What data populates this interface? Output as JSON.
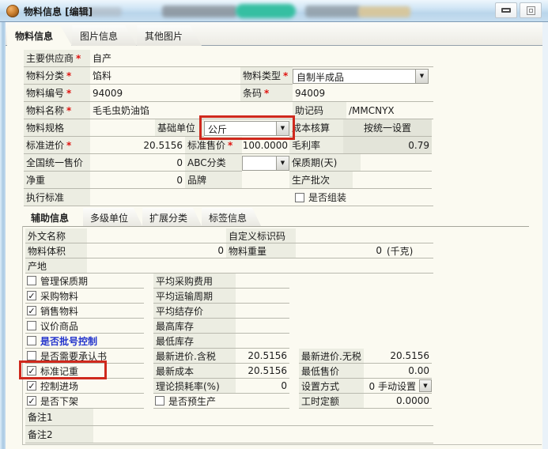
{
  "ui": {
    "required_marker": "*",
    "dropdown_arrow": "▼",
    "check_glyph": "✓"
  },
  "window": {
    "title": "物料信息 [编辑]"
  },
  "main_tabs": [
    {
      "label": "物料信息"
    },
    {
      "label": "图片信息"
    },
    {
      "label": "其他图片"
    }
  ],
  "aux_tabs": [
    {
      "label": "辅助信息"
    },
    {
      "label": "多级单位"
    },
    {
      "label": "扩展分类"
    },
    {
      "label": "标签信息"
    }
  ],
  "fields": {
    "supplier": {
      "label": "主要供应商",
      "value": "自产"
    },
    "category": {
      "label": "物料分类",
      "value": "馅料"
    },
    "type": {
      "label": "物料类型",
      "value": "自制半成品"
    },
    "code": {
      "label": "物料编号",
      "value": "94009"
    },
    "barcode": {
      "label": "条码",
      "value": "94009"
    },
    "name": {
      "label": "物料名称",
      "value": "毛毛虫奶油馅"
    },
    "mnemonic": {
      "label": "助记码",
      "value": "/MMCNYX"
    },
    "spec": {
      "label": "物料规格",
      "value": ""
    },
    "base_unit": {
      "label": "基础单位",
      "value": "公斤"
    },
    "cost_method": {
      "label": "成本核算",
      "value": "按统一设置"
    },
    "std_purchase": {
      "label": "标准进价",
      "value": "20.5156"
    },
    "std_sale": {
      "label": "标准售价",
      "value": "100.0000"
    },
    "margin": {
      "label": "毛利率",
      "value": "0.79"
    },
    "national_price": {
      "label": "全国统一售价",
      "value": "0"
    },
    "abc": {
      "label": "ABC分类",
      "value": ""
    },
    "shelf_life": {
      "label": "保质期(天)",
      "value": ""
    },
    "net_weight": {
      "label": "净重",
      "value": "0"
    },
    "brand": {
      "label": "品牌",
      "value": ""
    },
    "batch": {
      "label": "生产批次",
      "value": ""
    },
    "exec_std": {
      "label": "执行标准",
      "value": ""
    },
    "is_assembled": {
      "label": "是否组装",
      "checked": false
    }
  },
  "aux": {
    "foreign_name": {
      "label": "外文名称",
      "value": ""
    },
    "custom_id": {
      "label": "自定义标识码",
      "value": ""
    },
    "volume": {
      "label": "物料体积",
      "value": "0"
    },
    "weight": {
      "label": "物料重量",
      "value": "0",
      "unit": "(千克)"
    },
    "origin": {
      "label": "产地",
      "value": ""
    },
    "checks": [
      {
        "label": "管理保质期",
        "checked": false
      },
      {
        "label": "采购物料",
        "checked": true
      },
      {
        "label": "销售物料",
        "checked": true
      },
      {
        "label": "议价商品",
        "checked": false
      },
      {
        "label": "是否批号控制",
        "checked": false
      },
      {
        "label": "是否需要承认书",
        "checked": false
      },
      {
        "label": "标准记重",
        "checked": true
      },
      {
        "label": "控制进场",
        "checked": true
      },
      {
        "label": "是否下架",
        "checked": true
      }
    ],
    "mid": [
      {
        "label": "平均采购费用",
        "value": ""
      },
      {
        "label": "平均运输周期",
        "value": ""
      },
      {
        "label": "平均结存价",
        "value": ""
      },
      {
        "label": "最高库存",
        "value": ""
      },
      {
        "label": "最低库存",
        "value": ""
      },
      {
        "label": "最新进价.含税",
        "value": "20.5156"
      },
      {
        "label": "最新成本",
        "value": "20.5156"
      },
      {
        "label": "理论损耗率(%)",
        "value": "0"
      }
    ],
    "pre_production": {
      "label": "是否预生产",
      "checked": false
    },
    "right": [
      {
        "label": "最新进价.无税",
        "value": "20.5156"
      },
      {
        "label": "最低售价",
        "value": "0.00"
      },
      {
        "label": "设置方式",
        "value": "0 手动设置"
      },
      {
        "label": "工时定额",
        "value": "0.0000"
      }
    ],
    "remark1": {
      "label": "备注1",
      "value": ""
    },
    "remark2": {
      "label": "备注2",
      "value": ""
    }
  },
  "colors": {
    "highlight_box": "#cf291d",
    "link_text": "#2233cc",
    "titlebar_teal_blob": "#2fbe9e"
  }
}
